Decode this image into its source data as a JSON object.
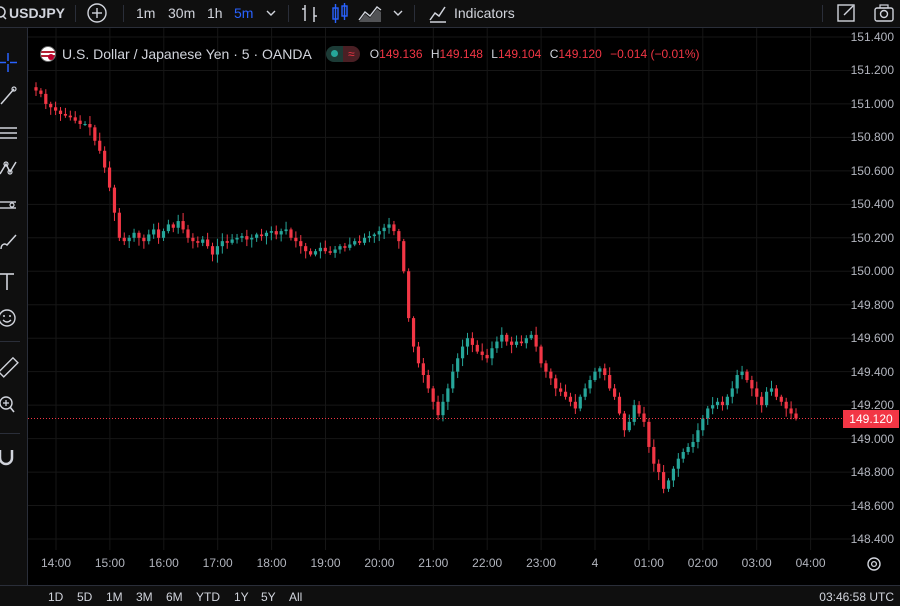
{
  "toolbar": {
    "symbol": "USDJPY",
    "timeframes": [
      "1m",
      "30m",
      "1h",
      "5m"
    ],
    "active_timeframe": "5m",
    "indicators_label": "Indicators"
  },
  "legend": {
    "title": "U.S. Dollar / Japanese Yen · 5 · OANDA",
    "o_label": "O",
    "o": "149.136",
    "h_label": "H",
    "h": "149.148",
    "l_label": "L",
    "l": "149.104",
    "c_label": "C",
    "c": "149.120",
    "change": "−0.014 (−0.01%)"
  },
  "price_axis": {
    "ticks": [
      "151.400",
      "151.200",
      "151.000",
      "150.800",
      "150.600",
      "150.400",
      "150.200",
      "150.000",
      "149.800",
      "149.600",
      "149.400",
      "149.200",
      "149.000",
      "148.800",
      "148.600",
      "148.400"
    ],
    "last_price": "149.120"
  },
  "time_axis": {
    "ticks": [
      "14:00",
      "15:00",
      "16:00",
      "17:00",
      "18:00",
      "19:00",
      "20:00",
      "21:00",
      "22:00",
      "23:00",
      "4",
      "01:00",
      "02:00",
      "03:00",
      "04:00"
    ]
  },
  "bottom": {
    "ranges": [
      "1D",
      "5D",
      "1M",
      "3M",
      "6M",
      "YTD",
      "1Y",
      "5Y",
      "All"
    ],
    "clock": "03:46:58 UTC"
  },
  "colors": {
    "up": "#26a69a",
    "down": "#f23645",
    "accent": "#2962ff",
    "background": "#000000"
  },
  "chart_data": {
    "type": "candlestick",
    "title": "U.S. Dollar / Japanese Yen · 5 · OANDA",
    "ylim": [
      148.4,
      151.45
    ],
    "x_ticks": [
      "14:00",
      "15:00",
      "16:00",
      "17:00",
      "18:00",
      "19:00",
      "20:00",
      "21:00",
      "22:00",
      "23:00",
      "4",
      "01:00",
      "02:00",
      "03:00",
      "04:00"
    ],
    "close_path": [
      151.08,
      151.06,
      151.0,
      150.98,
      150.96,
      150.94,
      150.93,
      150.92,
      150.9,
      150.88,
      150.88,
      150.86,
      150.78,
      150.72,
      150.62,
      150.5,
      150.35,
      150.2,
      150.18,
      150.2,
      150.23,
      150.2,
      150.18,
      150.22,
      150.25,
      150.2,
      150.24,
      150.28,
      150.26,
      150.3,
      150.25,
      150.2,
      150.18,
      150.17,
      150.19,
      150.15,
      150.1,
      150.15,
      150.18,
      150.17,
      150.19,
      150.2,
      150.21,
      150.19,
      150.2,
      150.22,
      150.21,
      150.23,
      150.24,
      150.22,
      150.24,
      150.25,
      150.2,
      150.18,
      150.15,
      150.12,
      150.1,
      150.12,
      150.14,
      150.12,
      150.11,
      150.13,
      150.15,
      150.14,
      150.16,
      150.18,
      150.17,
      150.2,
      150.21,
      150.22,
      150.24,
      150.26,
      150.28,
      150.24,
      150.18,
      150.0,
      149.72,
      149.55,
      149.45,
      149.38,
      149.3,
      149.22,
      149.14,
      149.22,
      149.3,
      149.4,
      149.48,
      149.55,
      149.6,
      149.56,
      149.52,
      149.5,
      149.48,
      149.54,
      149.58,
      149.62,
      149.58,
      149.56,
      149.58,
      149.57,
      149.6,
      149.62,
      149.55,
      149.45,
      149.4,
      149.36,
      149.3,
      149.28,
      149.25,
      149.22,
      149.18,
      149.25,
      149.3,
      149.35,
      149.4,
      149.42,
      149.38,
      149.3,
      149.25,
      149.15,
      149.05,
      149.1,
      149.2,
      149.15,
      149.1,
      148.95,
      148.85,
      148.8,
      148.7,
      148.75,
      148.82,
      148.88,
      148.92,
      148.95,
      148.98,
      149.05,
      149.12,
      149.18,
      149.2,
      149.22,
      149.2,
      149.25,
      149.3,
      149.38,
      149.4,
      149.35,
      149.3,
      149.25,
      149.2,
      149.28,
      149.3,
      149.25,
      149.22,
      149.18,
      149.15,
      149.12
    ],
    "last": 149.12
  }
}
